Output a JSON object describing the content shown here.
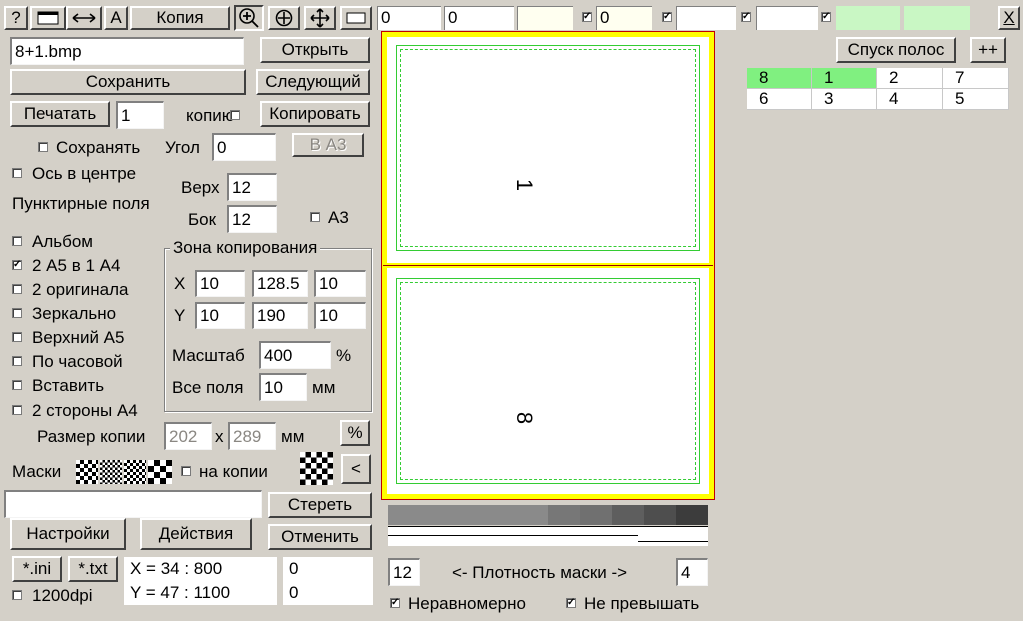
{
  "toolbar": {
    "help": "?",
    "letter": "A",
    "copy": "Копия",
    "field1": "0",
    "field2": "0",
    "field3": "",
    "field4": "0",
    "close": "X",
    "icons": [
      "rectangle-icon",
      "resize-horizontal-icon",
      "zoom-in-icon",
      "crosshair-icon",
      "move-icon",
      "frame-icon"
    ]
  },
  "file": {
    "name": "8+1.bmp",
    "open": "Открыть",
    "save": "Сохранить",
    "next": "Следующий",
    "print": "Печатать",
    "copies": "1",
    "copies_label": "копию",
    "copy_btn": "Копировать"
  },
  "options": {
    "keep": "Сохранять",
    "angle_label": "Угол",
    "angle": "0",
    "to_a3": "В А3",
    "axis_center": "Ось в центре",
    "dotted_fields": "Пунктирные поля",
    "top_label": "Верх",
    "top": "12",
    "side_label": "Бок",
    "side": "12",
    "a3": "А3",
    "album": "Альбом",
    "two_a5": "2 А5 в 1 А4",
    "two_originals": "2 оригинала",
    "mirror": "Зеркально",
    "top_a5": "Верхний А5",
    "clockwise": "По часовой",
    "insert": "Вставить",
    "two_sides": "2 стороны А4"
  },
  "copy_zone": {
    "title": "Зона копирования",
    "x_label": "X",
    "x": [
      "10",
      "128.5",
      "10"
    ],
    "y_label": "Y",
    "y": [
      "10",
      "190",
      "10"
    ],
    "scale_label": "Масштаб",
    "scale": "400",
    "scale_unit": "%",
    "all_fields_label": "Все поля",
    "all_fields": "10",
    "all_fields_unit": "мм"
  },
  "copy_size": {
    "label": "Размер копии",
    "w": "202",
    "x": "x",
    "h": "289",
    "unit": "мм",
    "percent": "%"
  },
  "masks": {
    "label": "Маски",
    "on_copy": "на копии",
    "prev": "<",
    "erase": "Стереть",
    "cancel": "Отменить"
  },
  "bottom": {
    "settings": "Настройки",
    "actions": "Действия",
    "ini": "*.ini",
    "txt": "*.txt",
    "dpi": "1200dpi",
    "coord_x": "X = 34 :  800",
    "coord_y": "Y = 47 :  1100",
    "val1": "0",
    "val2": "0"
  },
  "preview": {
    "page_top": "1",
    "page_bottom": "8"
  },
  "density": {
    "left": "12",
    "label": "<- Плотность маски ->",
    "right": "4",
    "uneven": "Неравномерно",
    "no_exceed": "Не превышать",
    "shades": [
      "#8a8a8a",
      "#8a8a8a",
      "#8a8a8a",
      "#8a8a8a",
      "#8a8a8a",
      "#777777",
      "#707070",
      "#5e5e5e",
      "#4e4e4e",
      "#3c3c3c"
    ]
  },
  "imposition": {
    "button": "Спуск полос",
    "plus": "++",
    "rows": [
      [
        "8",
        "1",
        "2",
        "7"
      ],
      [
        "6",
        "3",
        "4",
        "5"
      ]
    ]
  },
  "colors": {
    "page_border": "#ffff00",
    "guide": "#33cc33",
    "highlight": "#80f080"
  }
}
